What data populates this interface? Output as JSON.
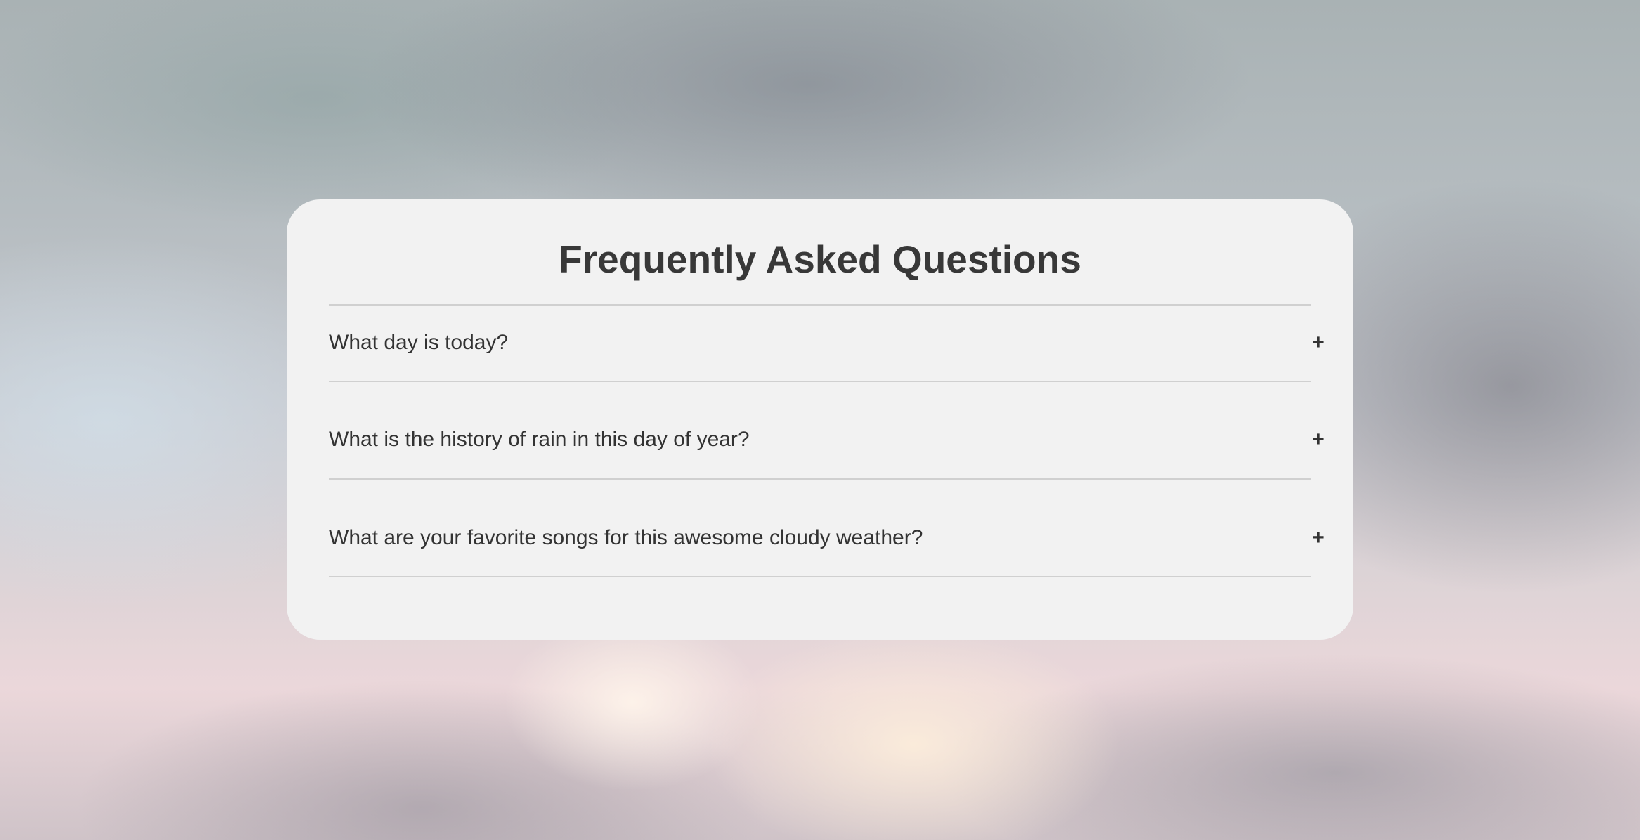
{
  "faq": {
    "title": "Frequently Asked Questions",
    "items": [
      {
        "question": "What day is today?",
        "toggle": "+"
      },
      {
        "question": "What is the history of rain in this day of year?",
        "toggle": "+"
      },
      {
        "question": "What are your favorite songs for this awesome cloudy weather?",
        "toggle": "+"
      }
    ]
  }
}
